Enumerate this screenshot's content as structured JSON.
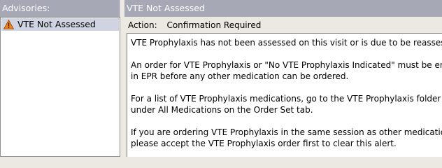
{
  "advisories": {
    "header": "Advisories:",
    "items": [
      {
        "label": "VTE Not Assessed",
        "icon": "warning-triangle-icon",
        "selected": true
      }
    ]
  },
  "detail": {
    "title": "VTE Not Assessed",
    "action_label": "Action:",
    "action_value": "Confirmation Required",
    "paragraphs": [
      "VTE Prophylaxis has not been assessed on this visit or is due to be reassessed.",
      "An order for VTE Prophylaxis or \"No VTE Prophylaxis Indicated\" must be entered\nin EPR before any other medication can be ordered.",
      "For a list of VTE Prophylaxis medications, go to the VTE Prophylaxis folder\nunder All Medications on the Order Set tab.",
      "If you are ordering VTE Prophylaxis in the same session as other medications,\nplease accept the VTE Prophylaxis order first to clear this alert."
    ]
  },
  "colors": {
    "header_bg": "#a6a8b5",
    "selected_row_bg": "#cfd3e2",
    "window_bg": "#ece9e2",
    "warning_orange": "#f0821e"
  }
}
